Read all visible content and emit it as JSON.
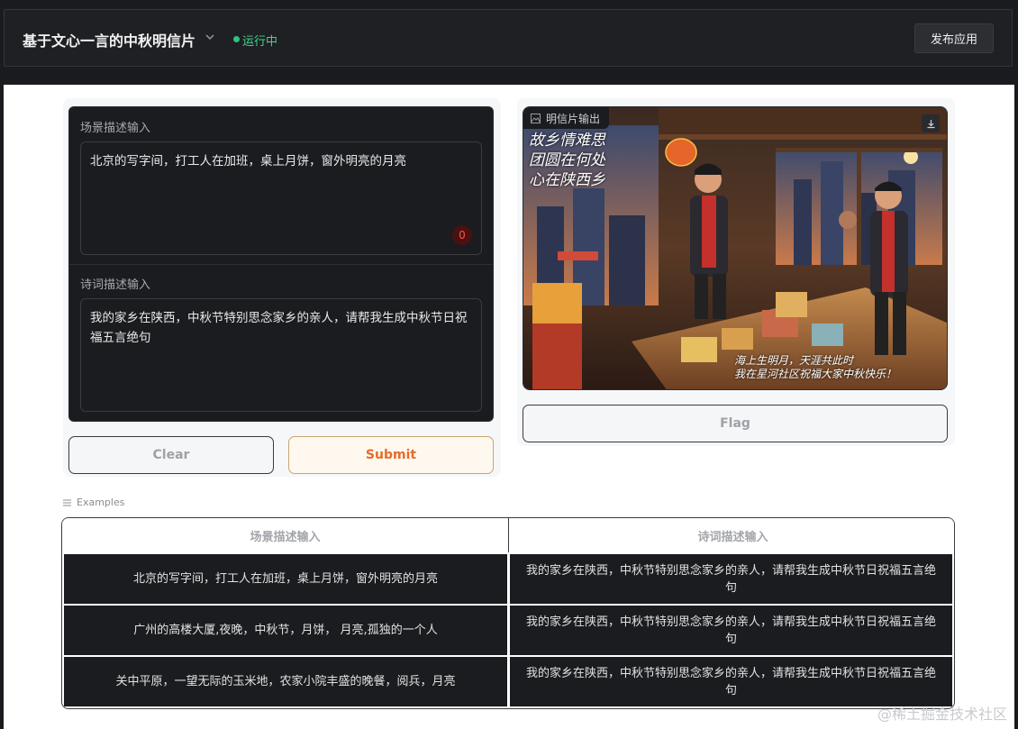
{
  "header": {
    "app_title": "基于文心一言的中秋明信片",
    "status": "运行中",
    "publish_label": "发布应用"
  },
  "inputs": {
    "scene_label": "场景描述输入",
    "scene_value": "北京的写字间，打工人在加班，桌上月饼，窗外明亮的月亮",
    "counter": "0",
    "poem_label": "诗词描述输入",
    "poem_value": "我的家乡在陕西，中秋节特别思念家乡的亲人，请帮我生成中秋节日祝福五言绝句"
  },
  "actions": {
    "clear_label": "Clear",
    "submit_label": "Submit",
    "flag_label": "Flag"
  },
  "output": {
    "label": "明信片输出",
    "poem_top": [
      "故乡情难思",
      "团圆在何处",
      "心在陕西乡"
    ],
    "poem_bottom": [
      "海上生明月，天涯共此时",
      "我在星河社区祝福大家中秋快乐！"
    ]
  },
  "examples": {
    "label": "Examples",
    "headers": [
      "场景描述输入",
      "诗词描述输入"
    ],
    "rows": [
      [
        "北京的写字间，打工人在加班，桌上月饼，窗外明亮的月亮",
        "我的家乡在陕西，中秋节特别思念家乡的亲人，请帮我生成中秋节日祝福五言绝句"
      ],
      [
        "广州的高楼大厦,夜晚，中秋节，月饼， 月亮,孤独的一个人",
        "我的家乡在陕西，中秋节特别思念家乡的亲人，请帮我生成中秋节日祝福五言绝句"
      ],
      [
        "关中平原，一望无际的玉米地，农家小院丰盛的晚餐，阅兵，月亮",
        "我的家乡在陕西，中秋节特别思念家乡的亲人，请帮我生成中秋节日祝福五言绝句"
      ]
    ]
  },
  "watermark": "@稀土掘金技术社区"
}
